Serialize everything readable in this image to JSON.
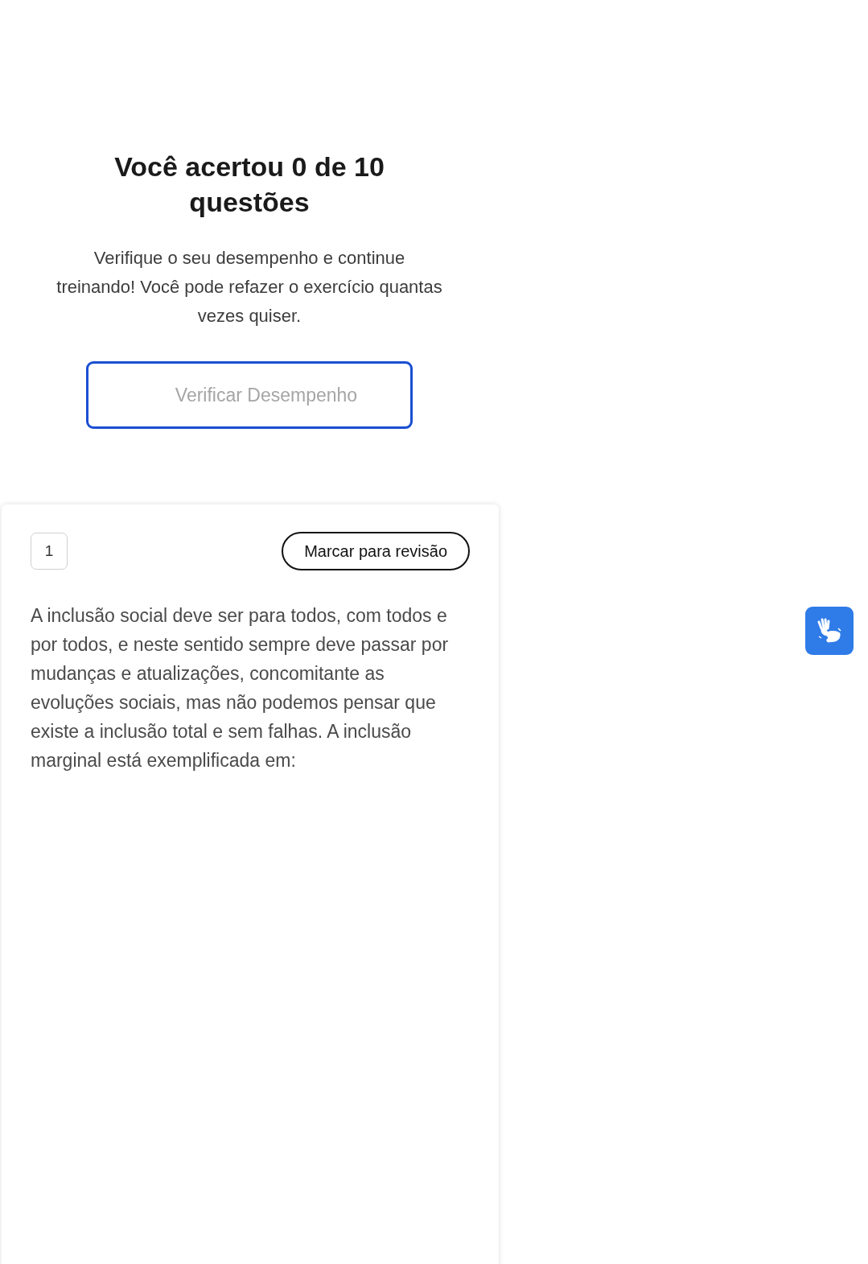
{
  "result": {
    "title": "Você acertou 0 de 10 questões",
    "message": "Verifique o seu desempenho e continue treinando! Você pode refazer o exercício quantas vezes quiser.",
    "button": {
      "label": "Verificar Desempenho",
      "disabled": true
    }
  },
  "question": {
    "number": "1",
    "review_button": "Marcar para revisão",
    "text": "A inclusão social deve ser para todos, com todos e por todos, e neste sentido sempre deve passar por mudanças e atualizações, concomitante as evoluções sociais, mas não podemos pensar que existe a inclusão total e sem falhas. A inclusão marginal está exemplificada em:"
  }
}
